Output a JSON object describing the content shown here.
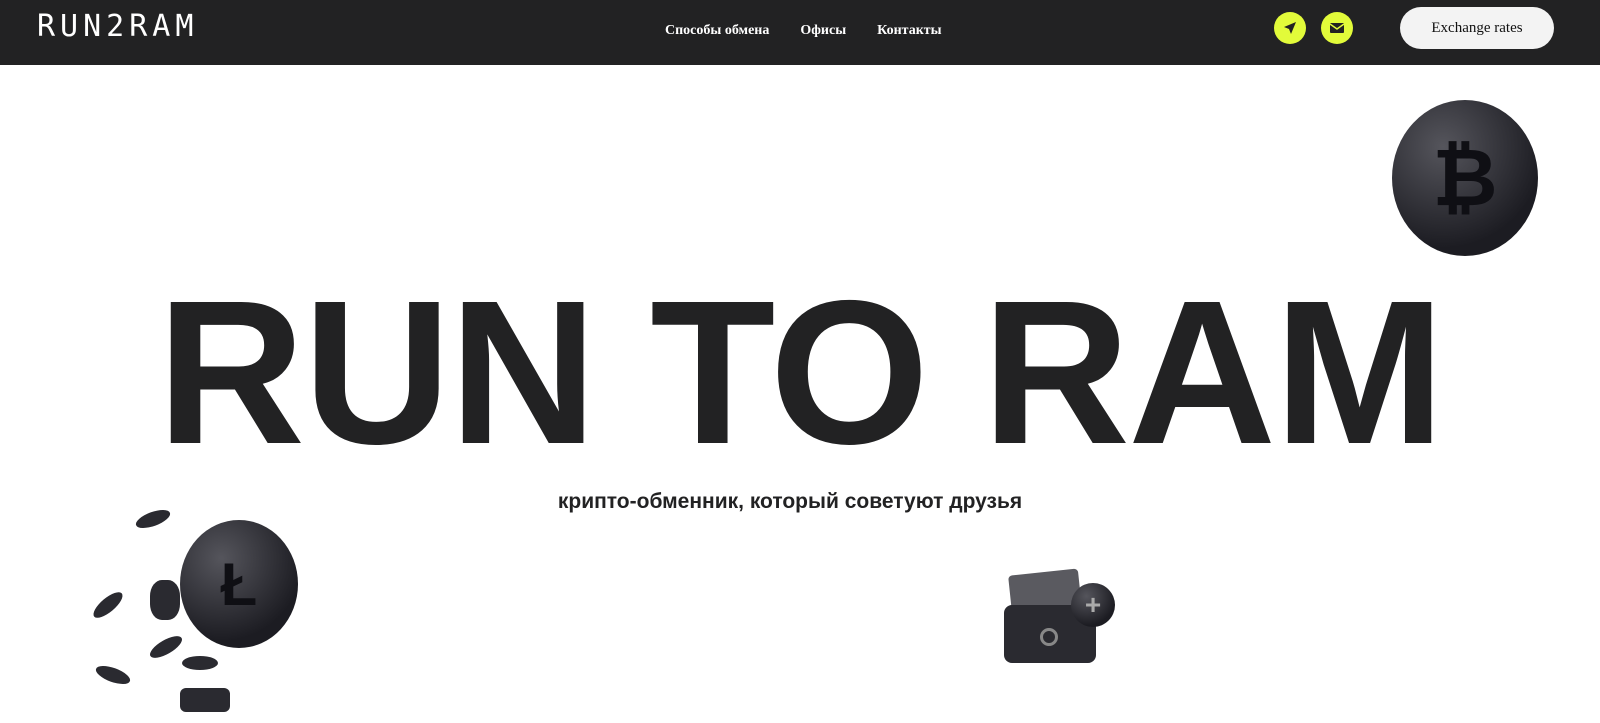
{
  "header": {
    "logo": "RUN2RAM",
    "nav": [
      "Способы обмена",
      "Офисы",
      "Контакты"
    ],
    "exchange_button": "Exchange rates"
  },
  "hero": {
    "title": "RUN TO RAM",
    "subtitle": "крипто-обменник, который советуют друзья"
  },
  "colors": {
    "header_bg": "#222223",
    "accent": "#e2fb3a"
  }
}
